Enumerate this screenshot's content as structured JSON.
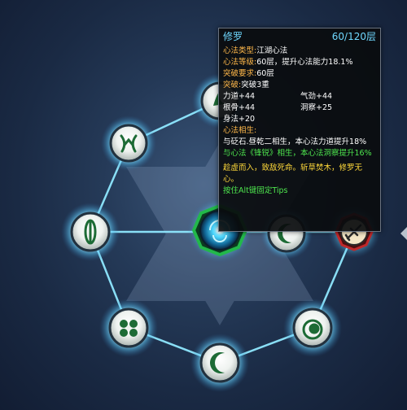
{
  "skill_tree": {
    "nodes": [
      {
        "name": "top-node",
        "icon": "flame-claw-icon",
        "state": "unlocked"
      },
      {
        "name": "upper-left-node",
        "icon": "claw-mark-icon",
        "state": "unlocked"
      },
      {
        "name": "left-node",
        "icon": "leaf-blade-icon",
        "state": "unlocked"
      },
      {
        "name": "lower-left-node",
        "icon": "clover-icon",
        "state": "unlocked"
      },
      {
        "name": "bottom-node",
        "icon": "crescent-moon-icon",
        "state": "unlocked"
      },
      {
        "name": "lower-right-node",
        "icon": "swirl-icon",
        "state": "unlocked"
      },
      {
        "name": "right-node",
        "icon": "sword-hand-icon",
        "state": "locked"
      },
      {
        "name": "inner-right-node",
        "icon": "crescent-moon-icon",
        "state": "unlocked"
      },
      {
        "name": "center-node",
        "icon": "vortex-core-icon",
        "state": "selected"
      }
    ],
    "colors": {
      "link": "#8fe8ff",
      "selected_ring": "#22b84a",
      "locked_ring": "#c0282a"
    }
  },
  "tooltip": {
    "name": "修罗",
    "level": "60/120层",
    "type_label": "心法类型:",
    "type_value": "江湖心法",
    "grade_label": "心法等级:",
    "grade_value": "60层，提升心法能力18.1%",
    "req_label": "突破要求:",
    "req_value": "60层",
    "break_label": "突破:",
    "break_value": "突破3重",
    "stats": [
      "力道+44",
      "气劲+44",
      "根骨+44",
      "洞察+25",
      "身法+20"
    ],
    "synergy_label": "心法相生:",
    "synergy_text_1": "与砭石.昼乾二相生，本心法力道提升18%",
    "synergy_text_2": "与心法《锋锐》相生，本心法洞察提升16%",
    "quote": "趁虚而入，致敌死命。斩草焚木，修罗无心。",
    "hint": "按住Alt键固定Tips"
  }
}
